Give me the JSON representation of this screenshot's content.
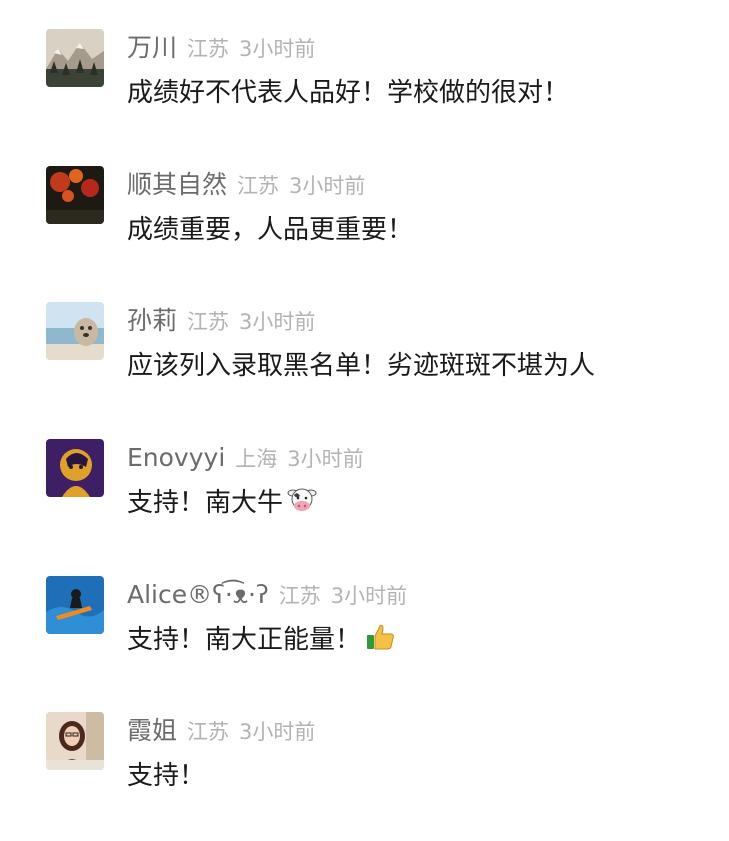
{
  "comments": [
    {
      "name": "万川",
      "location": "江苏",
      "time": "3小时前",
      "text": "成绩好不代表人品好！学校做的很对！",
      "avatar": "mountain-forest-avatar",
      "emoji": null
    },
    {
      "name": "顺其自然",
      "location": "江苏",
      "time": "3小时前",
      "text": "成绩重要，人品更重要！",
      "avatar": "red-maple-leaves-avatar",
      "emoji": null
    },
    {
      "name": "孙莉",
      "location": "江苏",
      "time": "3小时前",
      "text": "应该列入录取黑名单！劣迹斑斑不堪为人",
      "avatar": "seaside-dog-avatar",
      "emoji": null
    },
    {
      "name": "Enovyyi",
      "location": "上海",
      "time": "3小时前",
      "text": "支持！南大牛",
      "avatar": "purple-portrait-avatar",
      "emoji": "cow-face-icon"
    },
    {
      "name": "Alice®ʕ·͡ᴥ·ʔ",
      "location": "江苏",
      "time": "3小时前",
      "text": "支持！南大正能量！",
      "avatar": "blue-surfer-avatar",
      "emoji": "thumbs-up-icon"
    },
    {
      "name": "霞姐",
      "location": "江苏",
      "time": "3小时前",
      "text": "支持！",
      "avatar": "woman-at-desk-avatar",
      "emoji": null
    }
  ],
  "colors": {
    "name": "#6b6b6b",
    "meta": "#b3b3b3",
    "text": "#1a1a1a",
    "background": "#ffffff"
  }
}
